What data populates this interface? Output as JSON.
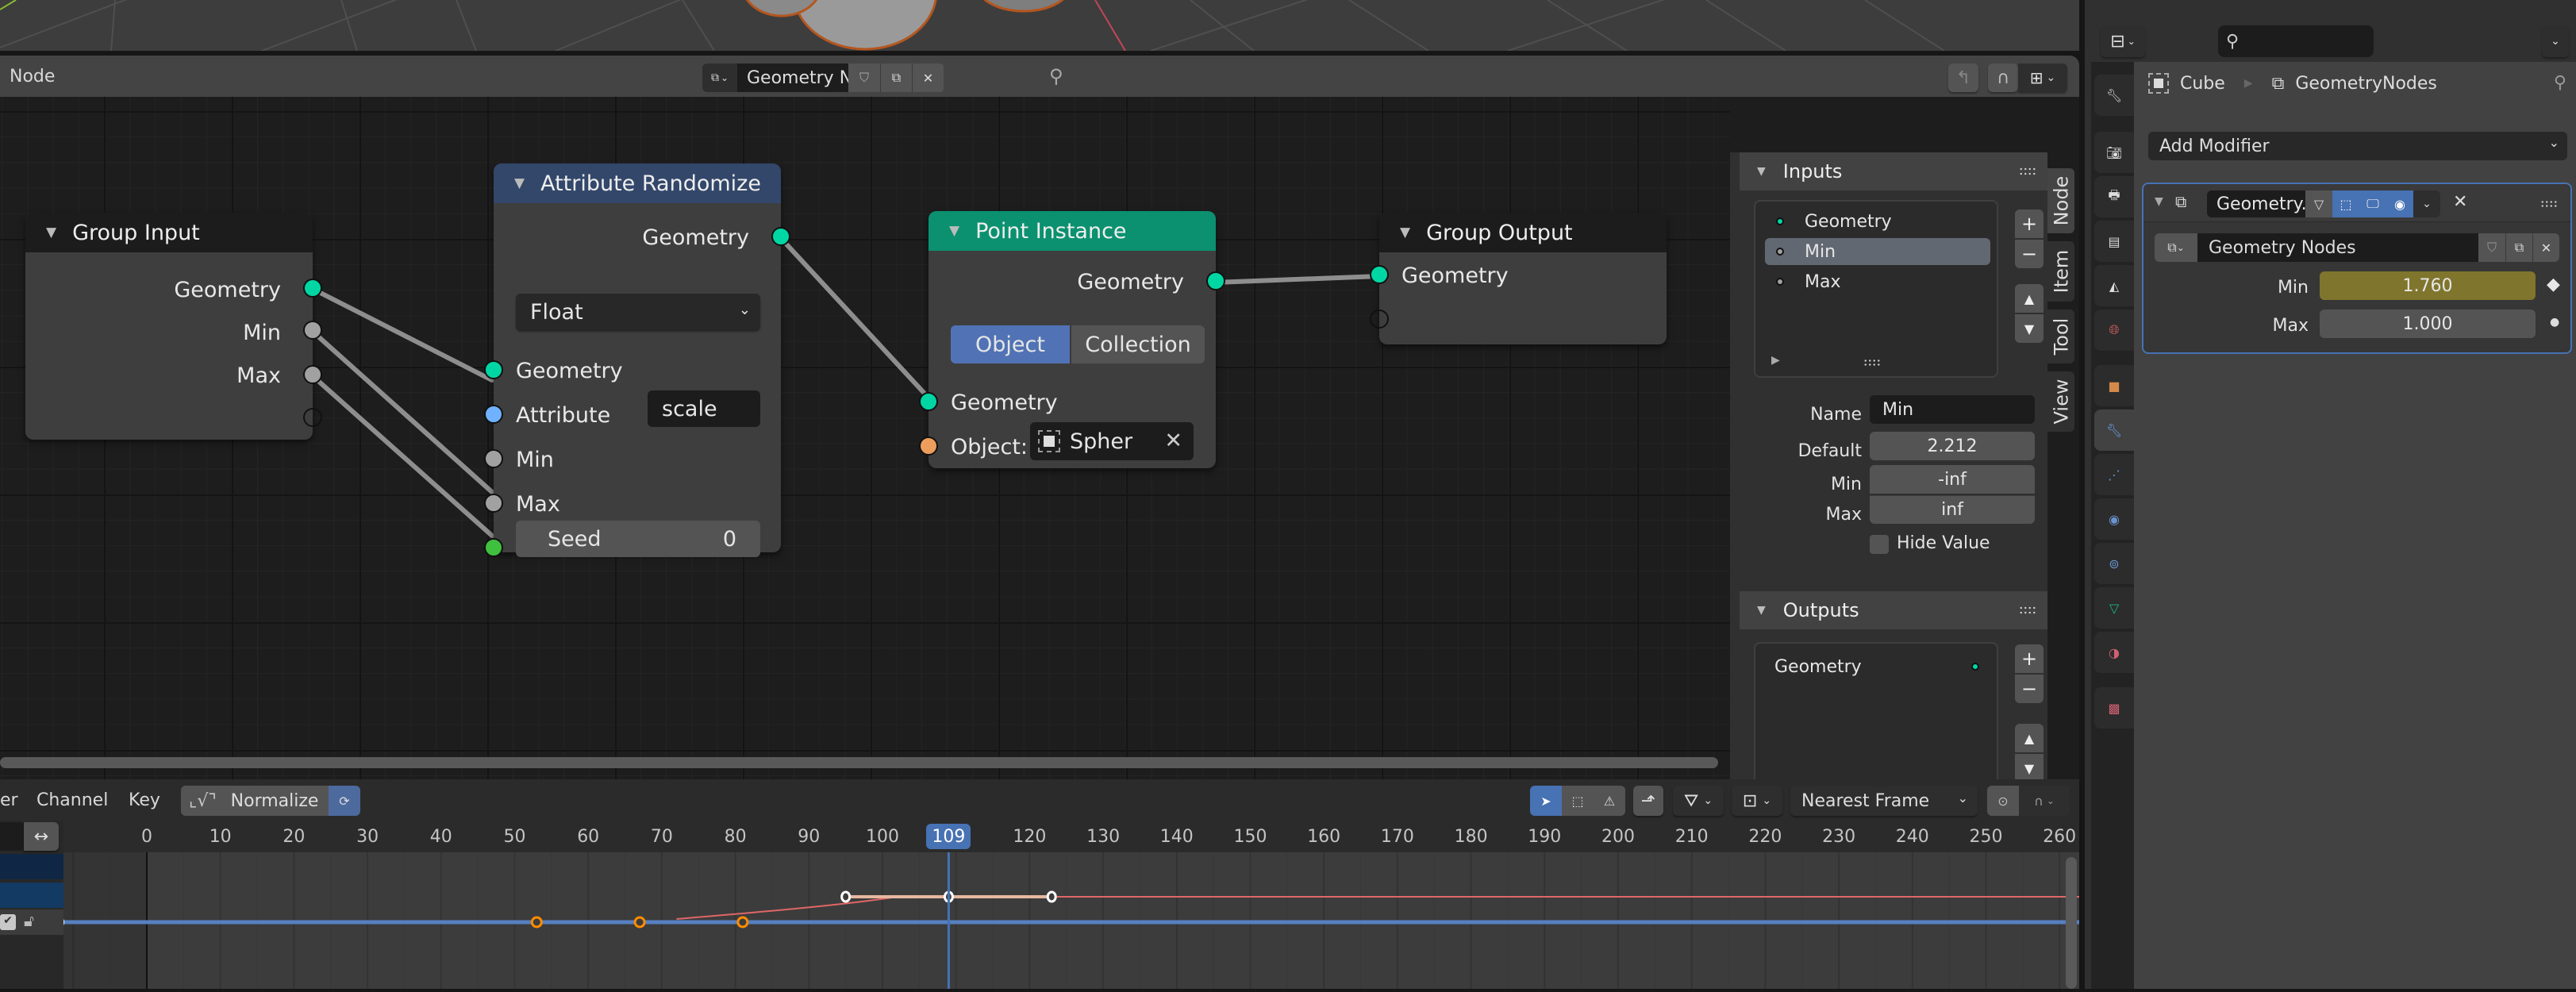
{
  "node_editor": {
    "header": {
      "menu_label": "Node",
      "node_tree_name": "Geometry Nodes"
    },
    "nodes": {
      "group_input": {
        "title": "Group Input",
        "outputs": [
          "Geometry",
          "Min",
          "Max"
        ]
      },
      "attribute_randomize": {
        "title": "Attribute Randomize",
        "output": "Geometry",
        "type_dropdown": "Float",
        "inputs": {
          "geometry": "Geometry",
          "attribute_label": "Attribute",
          "attribute_value": "scale",
          "min": "Min",
          "max": "Max",
          "seed_label": "Seed",
          "seed_value": "0"
        }
      },
      "point_instance": {
        "title": "Point Instance",
        "output": "Geometry",
        "mode_options": [
          "Object",
          "Collection"
        ],
        "mode_selected": "Object",
        "input_geometry": "Geometry",
        "object_label": "Object:",
        "object_value": "Spher"
      },
      "group_output": {
        "title": "Group Output",
        "inputs": [
          "Geometry"
        ]
      }
    },
    "sidebar": {
      "tabs": [
        "Node",
        "Item",
        "Tool",
        "View"
      ],
      "active_tab": "Node",
      "inputs_panel": {
        "title": "Inputs",
        "items": [
          {
            "label": "Geometry",
            "color": "#00d6a3"
          },
          {
            "label": "Min",
            "color": "#a1a1a1"
          },
          {
            "label": "Max",
            "color": "#a1a1a1"
          }
        ],
        "selected": "Min",
        "name_label": "Name",
        "name_value": "Min",
        "default_label": "Default",
        "default_value": "2.212",
        "min_label": "Min",
        "min_value": "-inf",
        "max_label": "Max",
        "max_value": "inf",
        "hide_value_label": "Hide Value",
        "hide_value_checked": false
      },
      "outputs_panel": {
        "title": "Outputs",
        "items": [
          {
            "label": "Geometry",
            "color": "#00d6a3"
          }
        ]
      }
    }
  },
  "properties": {
    "breadcrumb": {
      "object": "Cube",
      "modifier": "GeometryNodes"
    },
    "add_modifier_label": "Add Modifier",
    "modifier": {
      "name": "Geometry...",
      "node_group": "Geometry Nodes",
      "params": [
        {
          "label": "Min",
          "value": "1.760",
          "keyed": true
        },
        {
          "label": "Max",
          "value": "1.000",
          "keyed": false
        }
      ]
    }
  },
  "graph_editor": {
    "menus": [
      "er",
      "Channel",
      "Key"
    ],
    "normalize_label": "Normalize",
    "snap_mode": "Nearest Frame",
    "current_frame": "109",
    "ruler_ticks": [
      "0",
      "10",
      "20",
      "30",
      "40",
      "50",
      "60",
      "70",
      "80",
      "90",
      "100",
      "120",
      "130",
      "140",
      "150",
      "160",
      "170",
      "180",
      "190",
      "200",
      "210",
      "220",
      "230",
      "240",
      "250",
      "260"
    ],
    "colors": {
      "accent": "#4772b3",
      "curve_red": "#e06666",
      "curve_blue": "#5680c2",
      "keyframe_selected": "#ff8c00"
    }
  }
}
